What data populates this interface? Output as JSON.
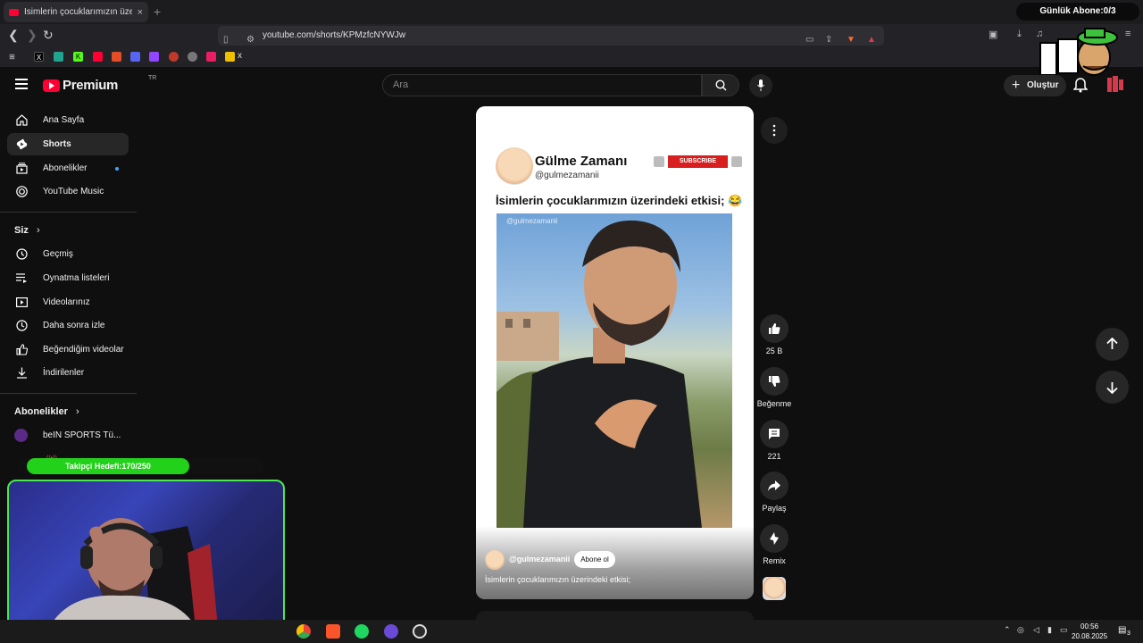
{
  "overlay": {
    "daily_goal": "Günlük Abone:0/3",
    "follower_goal": "Takipçi Hedefi:170/250",
    "follower_progress": 0.68
  },
  "browser": {
    "tab_title": "İsimlerin çocuklarımızın üzerind",
    "tab_close": "×",
    "new_tab": "+",
    "url": "youtube.com/shorts/KPMzfcNYWJw",
    "bookmark_folder": "x"
  },
  "header": {
    "logo": "Premium",
    "logo_region": "TR",
    "search_placeholder": "Ara",
    "create_label": "Oluştur"
  },
  "sidebar": {
    "main": [
      {
        "label": "Ana Sayfa",
        "icon": "home-icon"
      },
      {
        "label": "Shorts",
        "icon": "shorts-icon",
        "active": true
      },
      {
        "label": "Abonelikler",
        "icon": "subscriptions-icon"
      },
      {
        "label": "YouTube Music",
        "icon": "music-icon"
      }
    ],
    "you_heading": "Siz",
    "you": [
      {
        "label": "Geçmiş",
        "icon": "history-icon"
      },
      {
        "label": "Oynatma listeleri",
        "icon": "playlists-icon"
      },
      {
        "label": "Videolarınız",
        "icon": "your-videos-icon"
      },
      {
        "label": "Daha sonra izle",
        "icon": "watch-later-icon"
      },
      {
        "label": "Beğendiğim videolar",
        "icon": "liked-icon"
      },
      {
        "label": "İndirilenler",
        "icon": "downloads-icon"
      }
    ],
    "subs_heading": "Abonelikler",
    "subs": [
      {
        "label": "beIN SPORTS Tü...",
        "live": "((•))"
      }
    ]
  },
  "short": {
    "channel_name": "Gülme Zamanı",
    "channel_handle": "@gulmezamanii",
    "subscribe_label": "SUBSCRIBE",
    "caption": "İsimlerin çocuklarımızın üzerindeki etkisi; 😂",
    "watermark": "@gulmezamanii",
    "overlay_handle": "@gulmezamanii",
    "overlay_subscribe": "Abone ol",
    "overlay_caption": "İsimlerin çocuklarımızın üzerindeki etkisi;"
  },
  "actions": {
    "like_count": "25 B",
    "dislike_label": "Beğenme",
    "comment_count": "221",
    "share_label": "Paylaş",
    "remix_label": "Remix"
  },
  "taskbar": {
    "time": "00:56",
    "date": "20.08.2025",
    "notifications": "3"
  },
  "colors": {
    "yt_red": "#ff0033",
    "goal_green": "#22d11a",
    "webcam_border": "#49e94f",
    "subscribe_red": "#d81f1f"
  }
}
